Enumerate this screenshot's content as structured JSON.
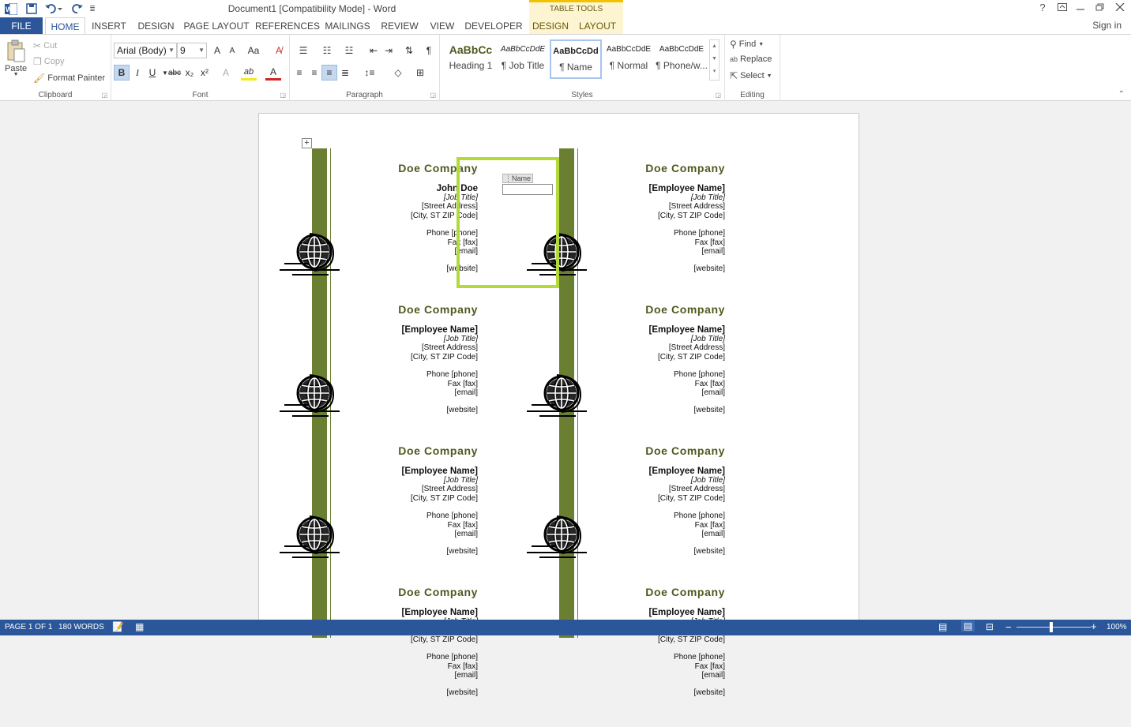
{
  "titlebar": {
    "title": "Document1 [Compatibility Mode] - Word",
    "contextual_label": "TABLE TOOLS",
    "help": "?",
    "qat_more": "≣"
  },
  "tabs": [
    "FILE",
    "HOME",
    "INSERT",
    "DESIGN",
    "PAGE LAYOUT",
    "REFERENCES",
    "MAILINGS",
    "REVIEW",
    "VIEW",
    "DEVELOPER",
    "DESIGN",
    "LAYOUT"
  ],
  "signin": "Sign in",
  "clipboard": {
    "paste": "Paste",
    "cut": "Cut",
    "copy": "Copy",
    "format_painter": "Format Painter",
    "group": "Clipboard"
  },
  "font": {
    "name": "Arial (Body)",
    "size": "9",
    "grow": "A",
    "shrink": "A",
    "case": "Aa",
    "bold": "B",
    "italic": "I",
    "underline": "U",
    "strike": "abc",
    "subscript": "x₂",
    "superscript": "x²",
    "effects": "A",
    "highlight": "ab",
    "color": "A",
    "group": "Font"
  },
  "paragraph": {
    "group": "Paragraph",
    "pilcrow": "¶"
  },
  "styles": {
    "group": "Styles",
    "items": [
      {
        "preview": "AaBbCc",
        "name": "Heading 1"
      },
      {
        "preview": "AaBbCcDdE",
        "name": "¶ Job Title"
      },
      {
        "preview": "AaBbCcDd",
        "name": "¶ Name"
      },
      {
        "preview": "AaBbCcDdE­",
        "name": "¶ Normal"
      },
      {
        "preview": "AaBbCcDdE­",
        "name": "¶ Phone/w..."
      }
    ]
  },
  "editing": {
    "find": "Find",
    "replace": "Replace",
    "select": "Select",
    "group": "Editing"
  },
  "card": {
    "company": "Doe Company",
    "employee": "[Employee Name]",
    "job": "[Job Title]",
    "street": "[Street Address]",
    "city": "[City, ST  ZIP Code]",
    "phone": "Phone [phone]",
    "fax": "Fax [fax]",
    "email": "[email]",
    "website": "[website]"
  },
  "first_card_name": "John Doe",
  "content_control_tag": "Name",
  "status": {
    "page": "PAGE 1 OF 1",
    "words": "180 WORDS",
    "zoom": "100%",
    "zoom_minus": "−",
    "zoom_plus": "+"
  },
  "colors": {
    "accent": "#2b579a",
    "bar_green": "#6a7f31",
    "company_green": "#4e5a1f",
    "selection_green": "#b4d93a"
  }
}
